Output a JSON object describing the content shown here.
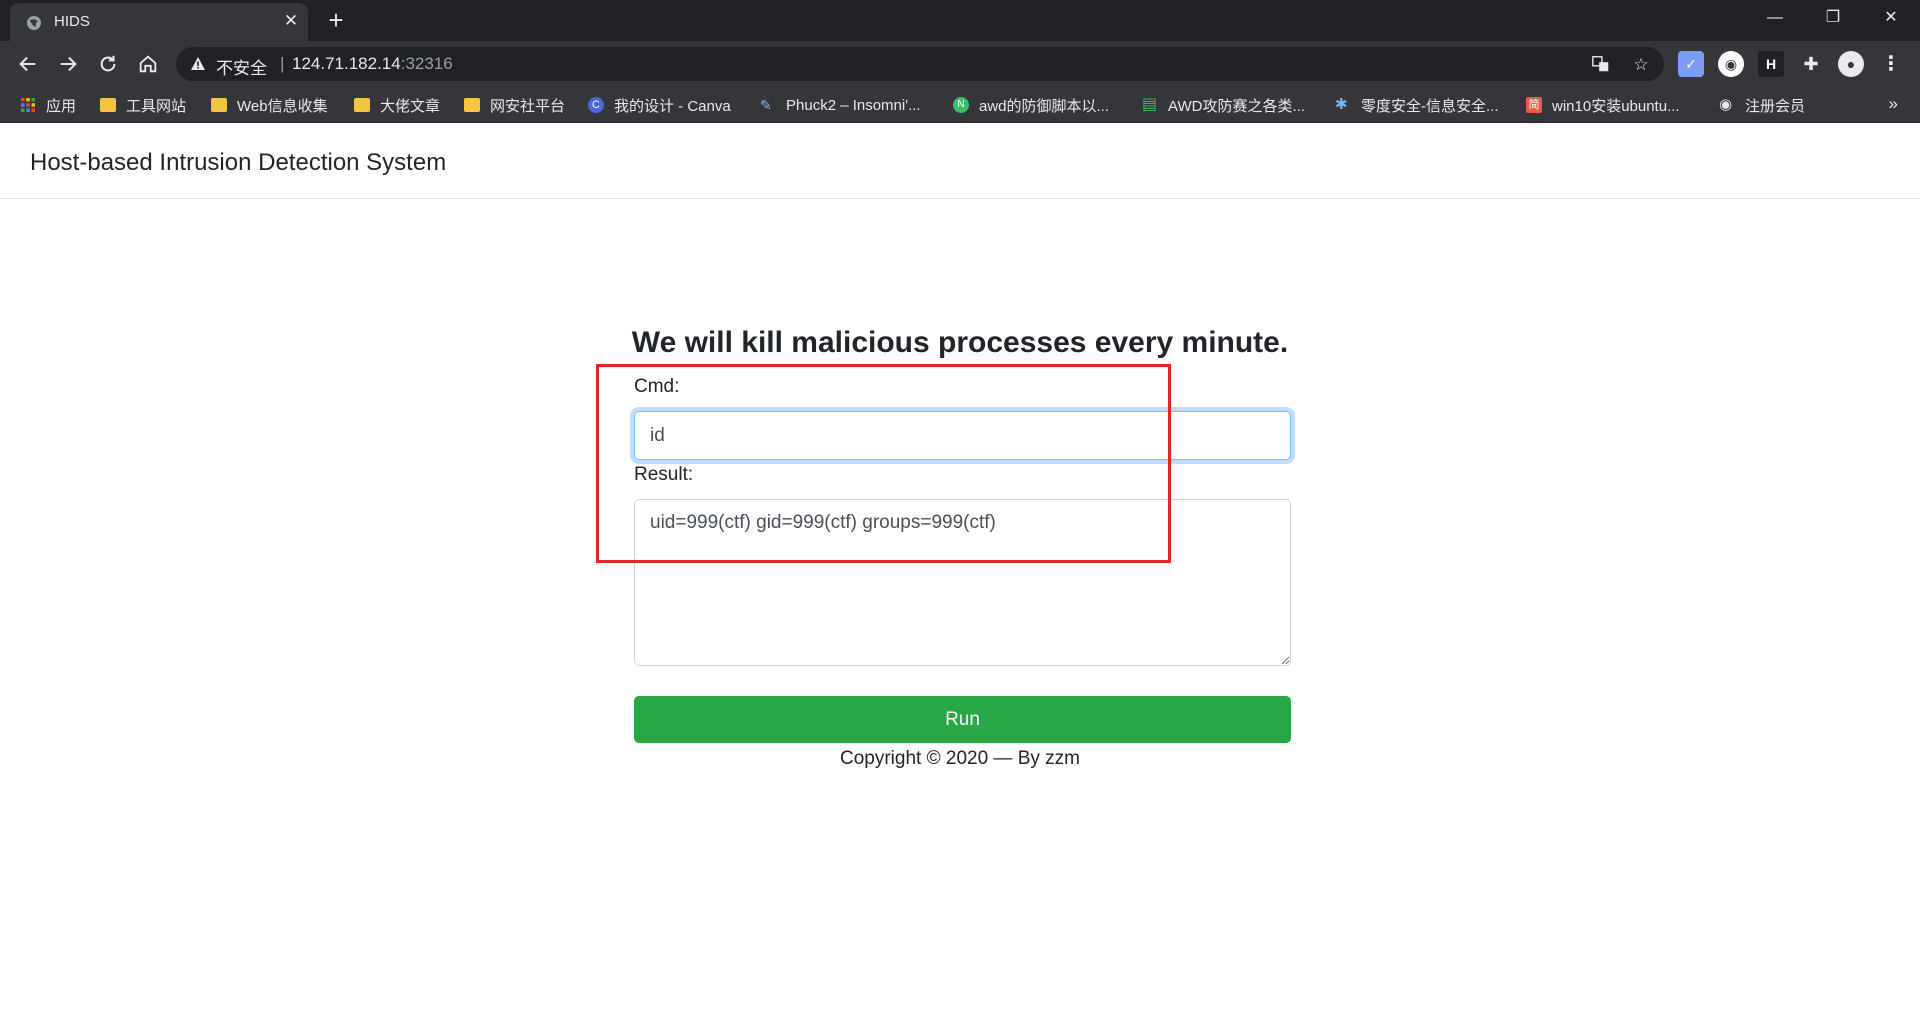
{
  "browser": {
    "tab_title": "HIDS",
    "tab_close": "✕",
    "new_tab": "+",
    "window_controls": {
      "minimize": "—",
      "restore": "❐",
      "close": "✕"
    },
    "address": {
      "insecure_label": "不安全",
      "separator": "|",
      "host": "124.71.182.14",
      "port": ":32316"
    },
    "bookmarks": [
      {
        "label": "应用",
        "icon": "apps-grid-icon"
      },
      {
        "label": "工具网站",
        "icon": "folder-icon"
      },
      {
        "label": "Web信息收集",
        "icon": "folder-icon"
      },
      {
        "label": "大佬文章",
        "icon": "folder-icon"
      },
      {
        "label": "网安社平台",
        "icon": "folder-icon"
      },
      {
        "label": "我的设计 - Canva",
        "icon": "canva-icon",
        "glyph": "C",
        "color": "#4a67e0"
      },
      {
        "label": "Phuck2 – Insomni'...",
        "icon": "page-icon",
        "glyph": "✎",
        "color": "#7fb0ff"
      },
      {
        "label": "awd的防御脚本以...",
        "icon": "n-icon",
        "glyph": "N",
        "color": "#3bbf6a"
      },
      {
        "label": "AWD攻防赛之各类...",
        "icon": "bars-icon",
        "glyph": "▤",
        "color": "#47b558"
      },
      {
        "label": "零度安全-信息安全...",
        "icon": "bug-icon",
        "glyph": "✱",
        "color": "#7ab6e8"
      },
      {
        "label": "win10安装ubuntu...",
        "icon": "jian-icon",
        "glyph": "简",
        "color": "#e55b4d"
      },
      {
        "label": "注册会员",
        "icon": "globe-icon",
        "glyph": "◉",
        "color": "#e8eaed"
      }
    ],
    "bookmarks_more": "»"
  },
  "page": {
    "brand": "Host-based Intrusion Detection System",
    "heading": "We will kill malicious processes every minute.",
    "cmd_label": "Cmd:",
    "cmd_value": "id",
    "result_label": "Result:",
    "result_value": "uid=999(ctf) gid=999(ctf) groups=999(ctf)",
    "run_label": "Run",
    "copyright": "Copyright © 2020 — By zzm"
  },
  "colors": {
    "run_button": "#28a745",
    "annotation_box": "#e5252a",
    "input_focus": "#80bdff"
  }
}
